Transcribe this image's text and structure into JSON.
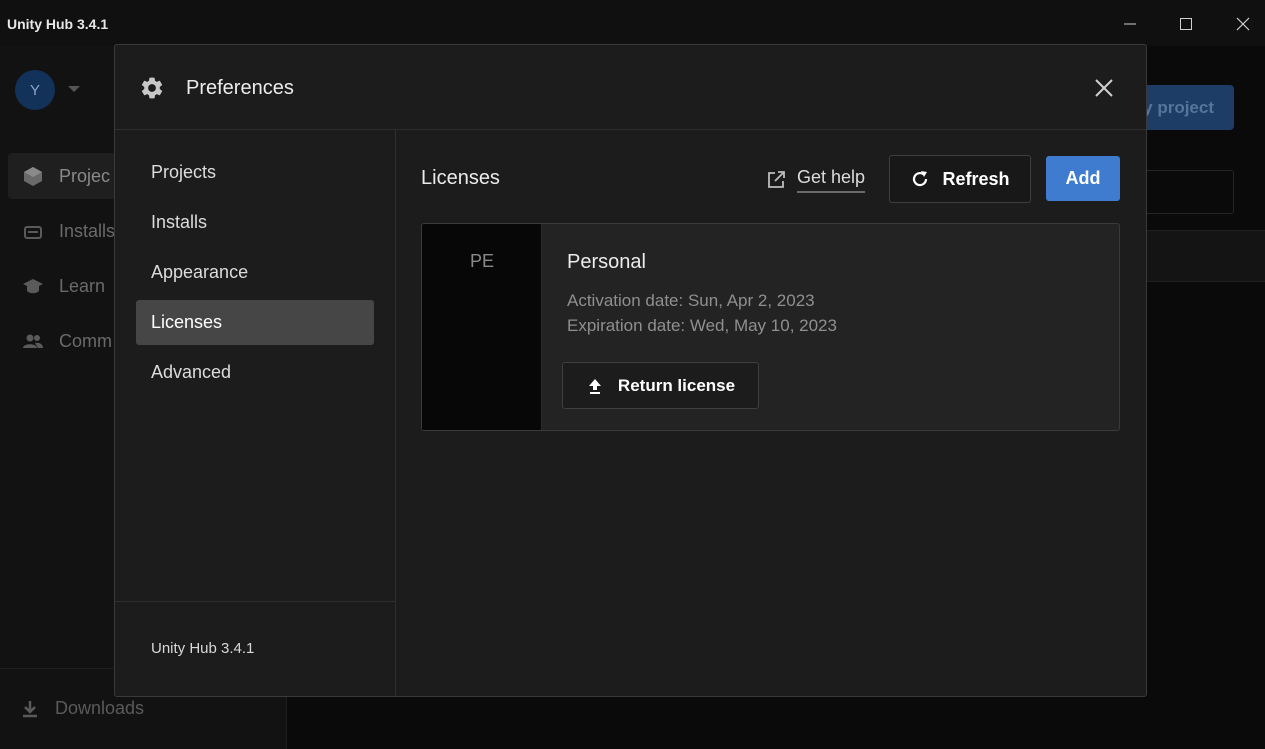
{
  "window": {
    "title": "Unity Hub 3.4.1",
    "controls": [
      "minimize",
      "maximize",
      "close"
    ]
  },
  "background": {
    "avatar_initial": "Y",
    "nav": [
      {
        "label": "Projec",
        "icon": "cube-icon"
      },
      {
        "label": "Installs",
        "icon": "installs-icon"
      },
      {
        "label": "Learn",
        "icon": "graduation-cap-icon"
      },
      {
        "label": "Comm",
        "icon": "people-icon"
      }
    ],
    "downloads_label": "Downloads",
    "new_project_label": "y project"
  },
  "preferences": {
    "title": "Preferences",
    "nav": [
      {
        "label": "Projects",
        "active": false
      },
      {
        "label": "Installs",
        "active": false
      },
      {
        "label": "Appearance",
        "active": false
      },
      {
        "label": "Licenses",
        "active": true
      },
      {
        "label": "Advanced",
        "active": false
      }
    ],
    "footer_version": "Unity Hub 3.4.1"
  },
  "licenses": {
    "heading": "Licenses",
    "get_help_label": "Get help",
    "refresh_label": "Refresh",
    "add_label": "Add",
    "items": [
      {
        "badge": "PE",
        "name": "Personal",
        "activation": "Activation date: Sun, Apr 2, 2023",
        "expiration": "Expiration date: Wed, May 10, 2023",
        "return_label": "Return license"
      }
    ]
  },
  "colors": {
    "accent": "#3f7ccf",
    "modal_bg": "#1c1c1c",
    "active_nav": "#464646"
  }
}
